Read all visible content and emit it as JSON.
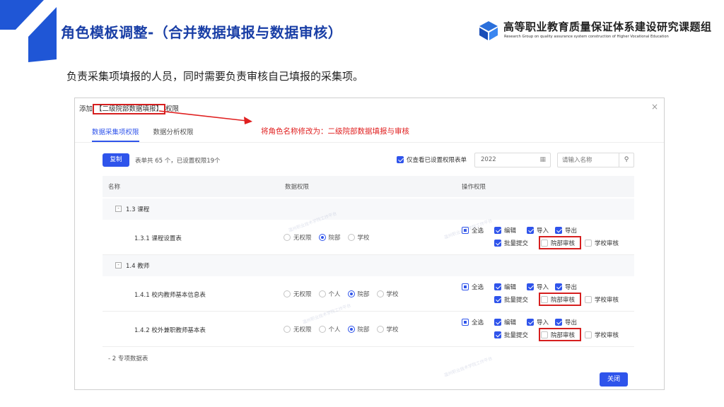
{
  "slide": {
    "title": "角色模板调整-（合并数据填报与数据审核）",
    "subtitle": "负责采集项填报的人员，同时需要负责审核自己填报的采集项。"
  },
  "logo": {
    "name_cn": "高等职业教育质量保证体系建设研究课题组",
    "name_en": "Research Group on quality assurance system construction of Higher Vocational Education"
  },
  "dialog": {
    "title_prefix": "添加",
    "title_highlight": "【二级院部数据填报】",
    "title_suffix": "权限",
    "close_symbol": "×",
    "annotation": "将角色名称修改为：二级院部数据填报与审核",
    "tabs": [
      {
        "label": "数据采集项权限",
        "active": true
      },
      {
        "label": "数据分析权限",
        "active": false
      }
    ],
    "toolbar": {
      "copy_label": "复制",
      "count_text": "表单共 65 个，已设置权限19个",
      "only_set_label": "仅查看已设置权限表单",
      "only_set_checked": true,
      "year_value": "2022",
      "search_placeholder": "请输入名称"
    },
    "table_headers": [
      "名称",
      "数据权限",
      "操作权限"
    ],
    "groups": [
      {
        "label": "1.3 课程",
        "items": [
          {
            "name": "1.3.1 课程设置表",
            "radios": [
              {
                "label": "无权限",
                "selected": false
              },
              {
                "label": "院部",
                "selected": true
              },
              {
                "label": "学校",
                "selected": false
              }
            ]
          }
        ]
      },
      {
        "label": "1.4 教师",
        "items": [
          {
            "name": "1.4.1 校内教师基本信息表",
            "radios": [
              {
                "label": "无权限",
                "selected": false
              },
              {
                "label": "个人",
                "selected": false
              },
              {
                "label": "院部",
                "selected": true
              },
              {
                "label": "学校",
                "selected": false
              }
            ]
          },
          {
            "name": "1.4.2 校外兼职教师基本表",
            "radios": [
              {
                "label": "无权限",
                "selected": false
              },
              {
                "label": "个人",
                "selected": false
              },
              {
                "label": "院部",
                "selected": true
              },
              {
                "label": "学校",
                "selected": false
              }
            ]
          }
        ]
      }
    ],
    "ops": {
      "select_all": "全选",
      "edit": "编辑",
      "import": "导入",
      "export": "导出",
      "batch_submit": "批量提交",
      "dept_review": "院部审核",
      "school_review": "学校审核"
    },
    "more_row_label": "2 专项数据表",
    "close_button": "关闭",
    "watermark": "温州职业技术学院工作平台"
  },
  "colors": {
    "primary": "#2f54eb",
    "title_blue": "#1a3fa6",
    "highlight_red": "#d61f1f"
  }
}
